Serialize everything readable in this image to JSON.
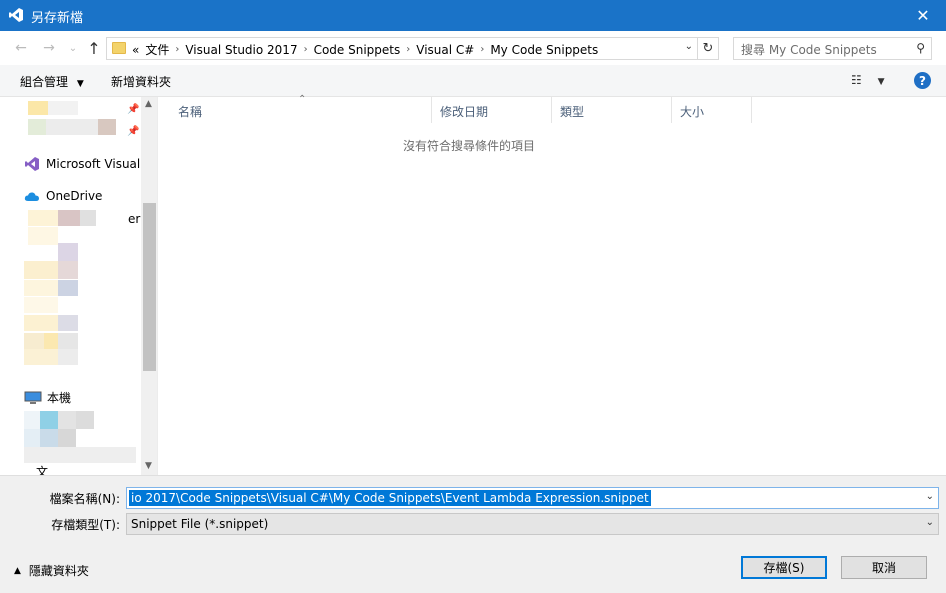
{
  "window": {
    "title": "另存新檔"
  },
  "nav": {
    "back_icon": "←",
    "forward_icon": "→",
    "recent_icon": "⌄",
    "up_icon": "↑"
  },
  "address": {
    "overflow": "«",
    "crumbs": [
      "文件",
      "Visual Studio 2017",
      "Code Snippets",
      "Visual C#",
      "My Code Snippets"
    ],
    "separator": "›"
  },
  "search": {
    "placeholder": "搜尋 My Code Snippets"
  },
  "toolbar": {
    "organize": "組合管理",
    "new_folder": "新增資料夾"
  },
  "navpane": {
    "items": [
      {
        "label": "Microsoft Visual",
        "icon": "visual-studio-icon"
      },
      {
        "label": "OneDrive",
        "icon": "onedrive-icon"
      },
      {
        "label": "er"
      },
      {
        "label": "本機",
        "icon": "computer-icon"
      },
      {
        "label": "文"
      }
    ]
  },
  "columns": [
    "名稱",
    "修改日期",
    "類型",
    "大小"
  ],
  "empty_message": "沒有符合搜尋條件的項目",
  "form": {
    "filename_label": "檔案名稱(N):",
    "filename_value": "io 2017\\Code Snippets\\Visual C#\\My Code Snippets\\Event Lambda Expression.snippet",
    "filetype_label": "存檔類型(T):",
    "filetype_value": "Snippet File (*.snippet)"
  },
  "footer": {
    "hide_folders": "隱藏資料夾",
    "save": "存檔(S)",
    "cancel": "取消"
  },
  "colors": {
    "titlebar": "#1a73c8",
    "accent": "#0078d7"
  }
}
